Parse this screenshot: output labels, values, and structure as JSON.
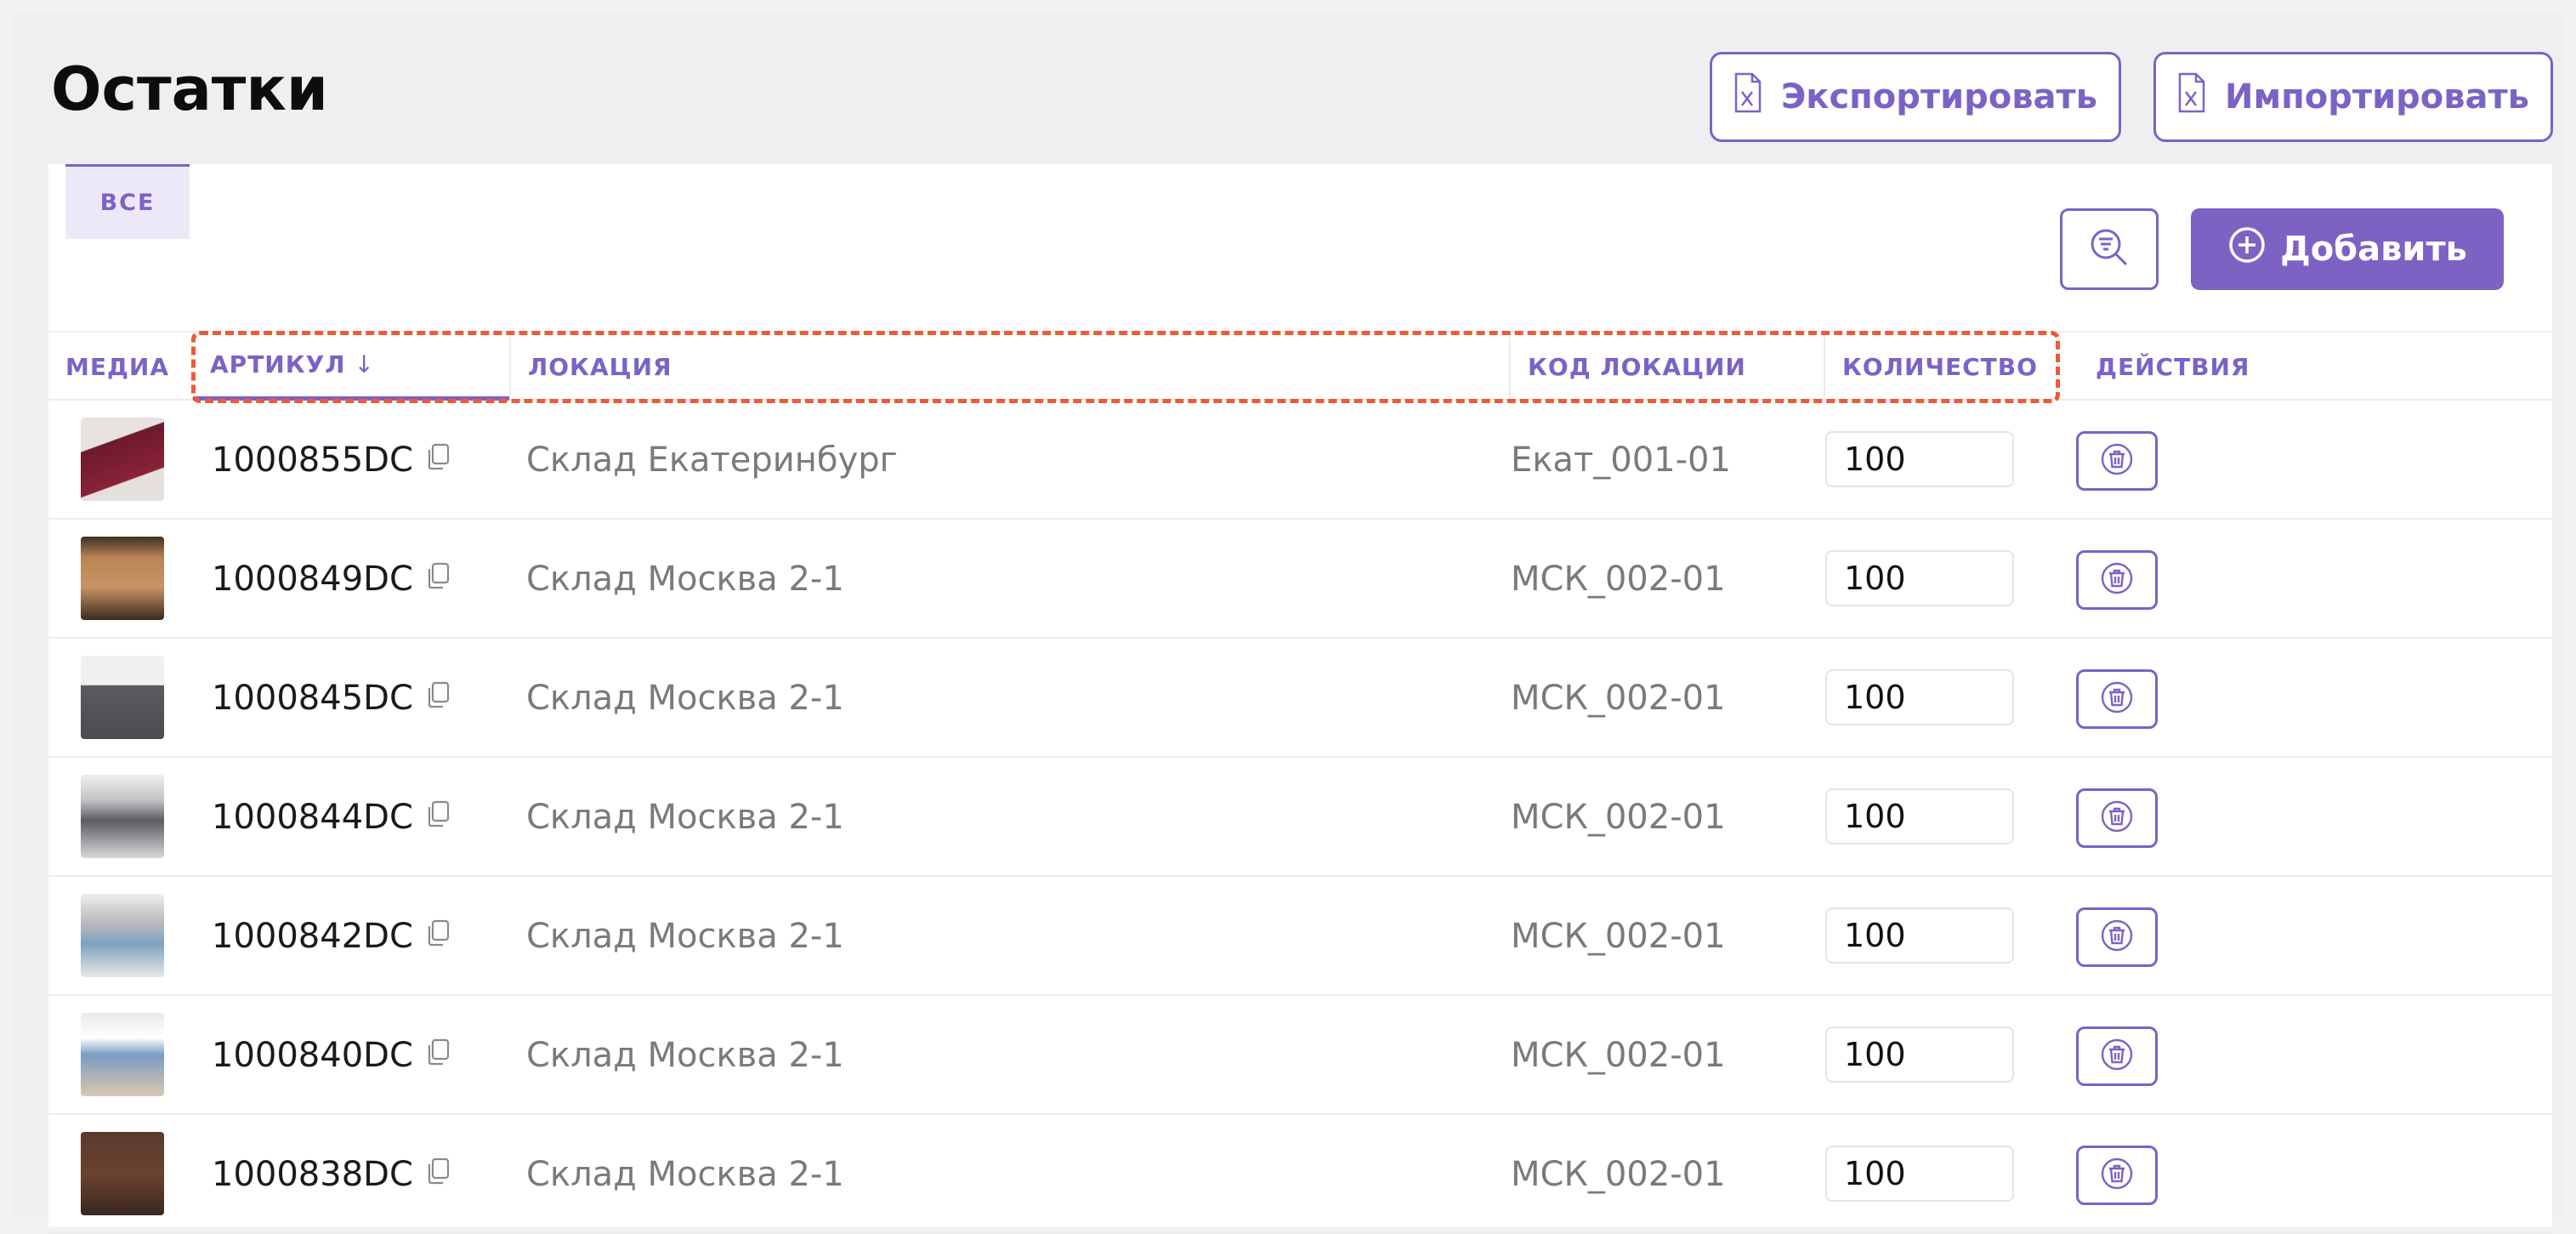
{
  "header": {
    "title": "Остатки",
    "export_label": "Экспортировать",
    "import_label": "Импортировать"
  },
  "tabs": [
    {
      "label": "ВСЕ"
    }
  ],
  "toolbar": {
    "filter_icon": "filter-search-icon",
    "add_label": "Добавить"
  },
  "table": {
    "columns": {
      "media": "МЕДИА",
      "sku": "АРТИКУЛ",
      "sku_sort": "↓",
      "location": "ЛОКАЦИЯ",
      "location_code": "КОД ЛОКАЦИИ",
      "quantity": "КОЛИЧЕСТВО",
      "actions": "ДЕЙСТВИЯ"
    },
    "rows": [
      {
        "sku": "1000855DC",
        "location": "Склад Екатеринбург",
        "code": "Екат_001-01",
        "quantity": "100"
      },
      {
        "sku": "1000849DC",
        "location": "Склад Москва 2-1",
        "code": "МСК_002-01",
        "quantity": "100"
      },
      {
        "sku": "1000845DC",
        "location": "Склад Москва 2-1",
        "code": "МСК_002-01",
        "quantity": "100"
      },
      {
        "sku": "1000844DC",
        "location": "Склад Москва 2-1",
        "code": "МСК_002-01",
        "quantity": "100"
      },
      {
        "sku": "1000842DC",
        "location": "Склад Москва 2-1",
        "code": "МСК_002-01",
        "quantity": "100"
      },
      {
        "sku": "1000840DC",
        "location": "Склад Москва 2-1",
        "code": "МСК_002-01",
        "quantity": "100"
      },
      {
        "sku": "1000838DC",
        "location": "Склад Москва 2-1",
        "code": "МСК_002-01",
        "quantity": "100"
      }
    ]
  },
  "colors": {
    "accent": "#7b63c6",
    "highlight": "#ee5a37"
  }
}
